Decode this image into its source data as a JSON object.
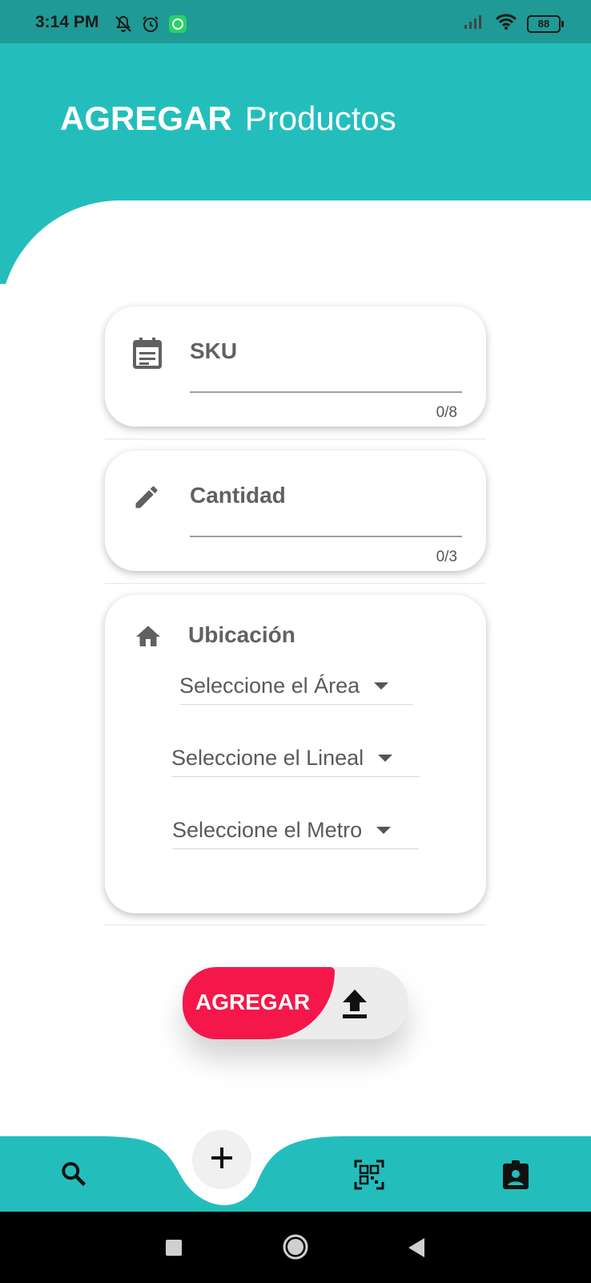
{
  "status_bar": {
    "time": "3:14 PM",
    "battery": "88"
  },
  "header": {
    "title_strong": "AGREGAR",
    "title_rest": "Productos"
  },
  "form": {
    "sku": {
      "label": "SKU",
      "counter": "0/8"
    },
    "cantidad": {
      "label": "Cantidad",
      "counter": "0/3"
    },
    "ubicacion": {
      "label": "Ubicación",
      "area_placeholder": "Seleccione el Área",
      "lineal_placeholder": "Seleccione el Lineal",
      "metro_placeholder": "Seleccione el Metro"
    }
  },
  "actions": {
    "agregar_label": "AGREGAR"
  },
  "colors": {
    "header": "#23bebc",
    "status_bar": "#1f9a96",
    "accent_red": "#f5174a",
    "label_gray": "#616161"
  },
  "bottom_nav": {
    "items": [
      "search-icon",
      "add-icon",
      "qr-scan-icon",
      "profile-badge-icon"
    ]
  }
}
